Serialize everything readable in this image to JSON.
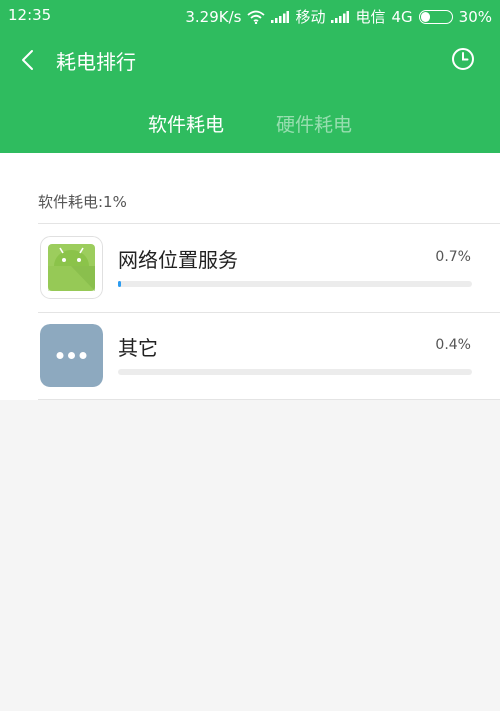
{
  "status_bar": {
    "time": "12:35",
    "speed": "3.29K/s",
    "carrier1": "移动",
    "carrier2": "电信",
    "network": "4G",
    "battery": "30%",
    "battery_level": 0.3
  },
  "header": {
    "title": "耗电排行",
    "tabs": [
      {
        "label": "软件耗电",
        "active": true
      },
      {
        "label": "硬件耗电",
        "active": false
      }
    ],
    "color": "#2fbc5f"
  },
  "section": {
    "label": "软件耗电:1%"
  },
  "apps": [
    {
      "name": "网络位置服务",
      "percent": "0.7%",
      "level": 0.007,
      "icon": "android-icon"
    },
    {
      "name": "其它",
      "percent": "0.4%",
      "level": 0.004,
      "icon": "more-icon"
    }
  ]
}
